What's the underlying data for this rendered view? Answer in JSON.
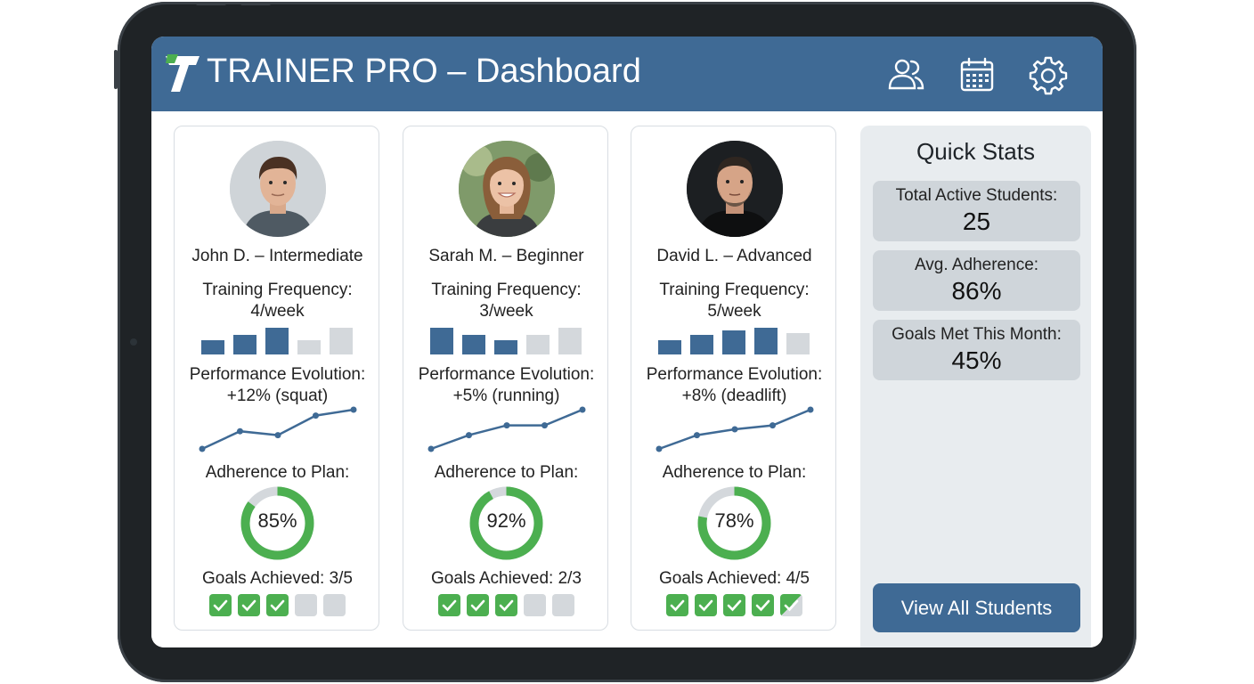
{
  "header": {
    "title": "TRAINER PRO – Dashboard",
    "icons": [
      "users-icon",
      "calendar-icon",
      "gear-icon"
    ]
  },
  "colors": {
    "header": "#3f6a95",
    "bar_active": "#3f6a95",
    "bar_inactive": "#d4d8dc",
    "progress": "#4caf50",
    "button": "#3f6a95"
  },
  "students": [
    {
      "name": "John D. – Intermediate",
      "frequency_label": "Training Frequency:",
      "frequency_value": "4/week",
      "weekly_bars": [
        0.5,
        0.7,
        0.95,
        0.5,
        0.95
      ],
      "weekly_active": [
        true,
        true,
        true,
        false,
        false
      ],
      "performance_label": "Performance Evolution:",
      "performance_value": "+12% (squat)",
      "performance_trend": [
        0.0,
        0.45,
        0.35,
        0.85,
        1.0
      ],
      "adherence_label": "Adherence to Plan:",
      "adherence_text": "85%",
      "adherence": 0.85,
      "goals_text": "Goals Achieved: 3/5",
      "goals": [
        1,
        1,
        1,
        0,
        0
      ]
    },
    {
      "name": "Sarah M. – Beginner",
      "frequency_label": "Training Frequency:",
      "frequency_value": "3/week",
      "weekly_bars": [
        0.95,
        0.7,
        0.5,
        0.7,
        0.95
      ],
      "weekly_active": [
        true,
        true,
        true,
        false,
        false
      ],
      "performance_label": "Performance Evolution:",
      "performance_value": "+5% (running)",
      "performance_trend": [
        0.0,
        0.35,
        0.6,
        0.6,
        1.0
      ],
      "adherence_label": "Adherence to Plan:",
      "adherence_text": "92%",
      "adherence": 0.92,
      "goals_text": "Goals Achieved: 2/3",
      "goals": [
        1,
        1,
        1,
        0,
        0
      ]
    },
    {
      "name": "David L. – Advanced",
      "frequency_label": "Training Frequency:",
      "frequency_value": "5/week",
      "weekly_bars": [
        0.5,
        0.7,
        0.85,
        0.95,
        0.75
      ],
      "weekly_active": [
        true,
        true,
        true,
        true,
        false
      ],
      "performance_label": "Performance Evolution:",
      "performance_value": "+8% (deadlift)",
      "performance_trend": [
        0.0,
        0.35,
        0.5,
        0.6,
        1.0
      ],
      "adherence_label": "Adherence to Plan:",
      "adherence_text": "78%",
      "adherence": 0.78,
      "goals_text": "Goals Achieved: 4/5",
      "goals": [
        1,
        1,
        1,
        1,
        0.5
      ]
    }
  ],
  "quick_stats": {
    "title": "Quick Stats",
    "items": [
      {
        "label": "Total Active Students:",
        "value": "25"
      },
      {
        "label": "Avg. Adherence:",
        "value": "86%"
      },
      {
        "label": "Goals Met This Month:",
        "value": "45%"
      }
    ],
    "button_label": "View All Students"
  }
}
